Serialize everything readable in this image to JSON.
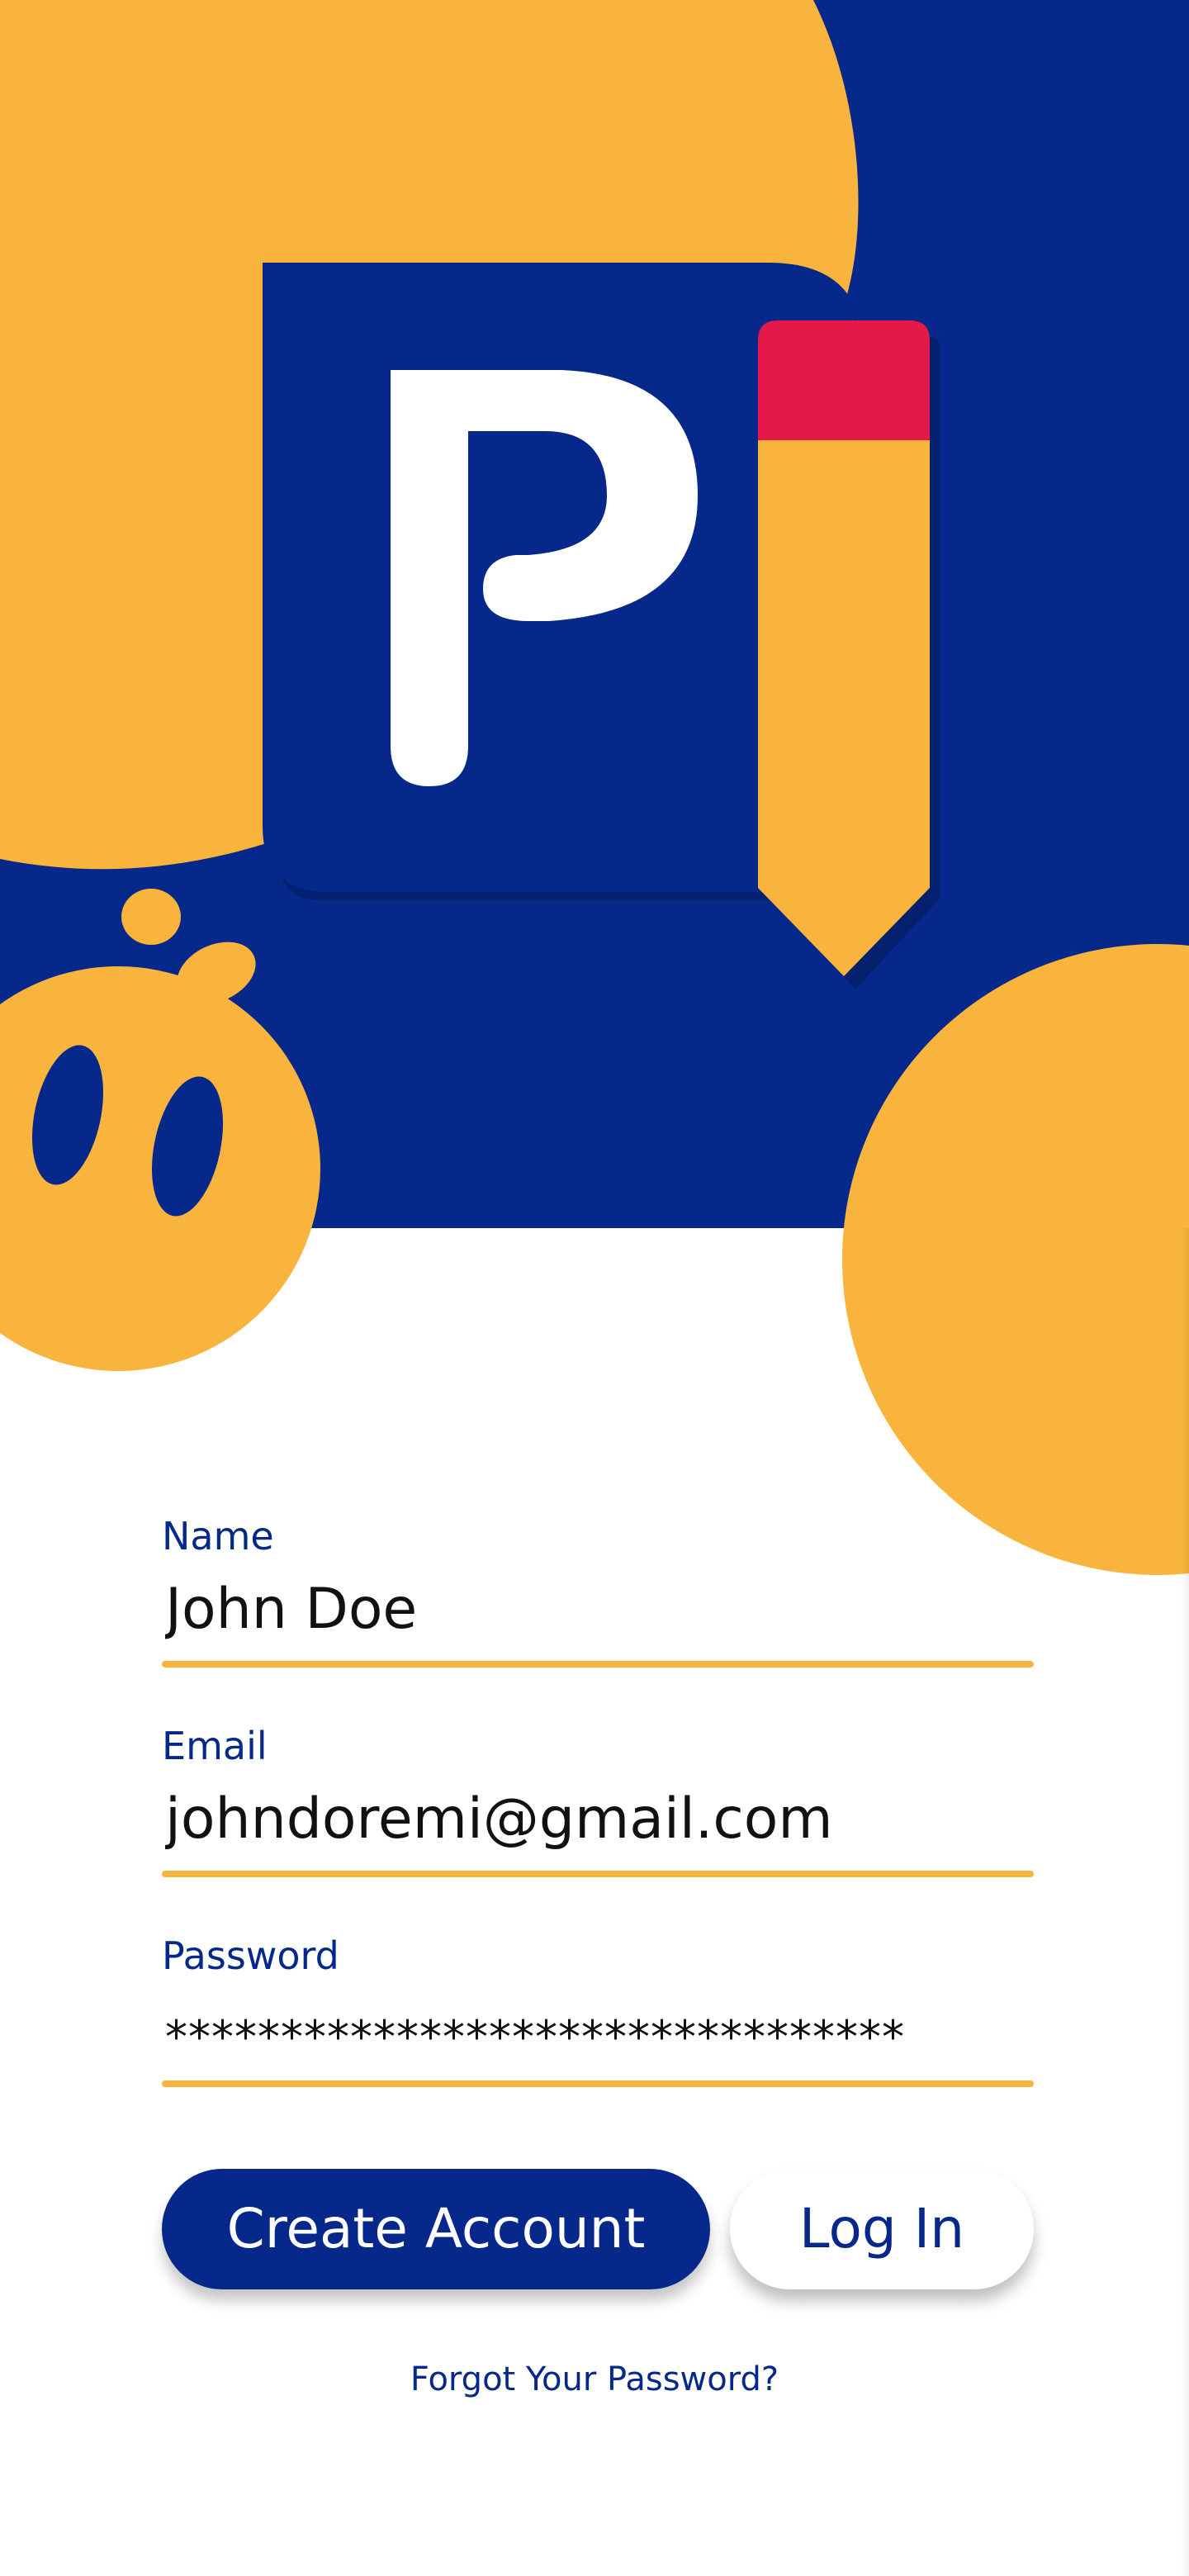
{
  "colors": {
    "primary": "#06288A",
    "accent": "#F8B43C",
    "pencil_tip": "#E4194A",
    "background": "#FFFFFF"
  },
  "logo": {
    "icon": "pi-pencil-logo-icon",
    "letter": "P"
  },
  "mascot": {
    "icon": "mascot-face-icon"
  },
  "form": {
    "name": {
      "label": "Name",
      "value": "John Doe"
    },
    "email": {
      "label": "Email",
      "value": "johndoremi@gmail.com"
    },
    "password": {
      "label": "Password",
      "value": "********************************"
    }
  },
  "actions": {
    "create_account": "Create Account",
    "log_in": "Log In",
    "forgot_password": "Forgot Your Password?"
  }
}
